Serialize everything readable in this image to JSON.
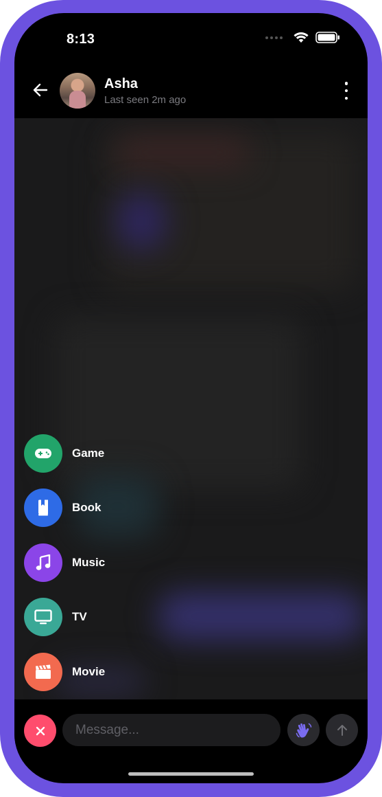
{
  "status_bar": {
    "time": "8:13"
  },
  "header": {
    "contact_name": "Asha",
    "last_seen": "Last seen 2m ago"
  },
  "attach_menu": {
    "items": [
      {
        "label": "Game",
        "icon": "gamepad-icon",
        "color": "#22a46a"
      },
      {
        "label": "Book",
        "icon": "book-icon",
        "color": "#2e6be6"
      },
      {
        "label": "Music",
        "icon": "music-note-icon",
        "color": "#8b45e8"
      },
      {
        "label": "TV",
        "icon": "tv-icon",
        "color": "#3aa896"
      },
      {
        "label": "Movie",
        "icon": "clapperboard-icon",
        "color": "#f26a4f"
      }
    ]
  },
  "composer": {
    "placeholder": "Message...",
    "value": ""
  },
  "colors": {
    "frame": "#6c52e0",
    "close_button": "#ff4d6d",
    "wave_icon": "#7a6cf0"
  }
}
